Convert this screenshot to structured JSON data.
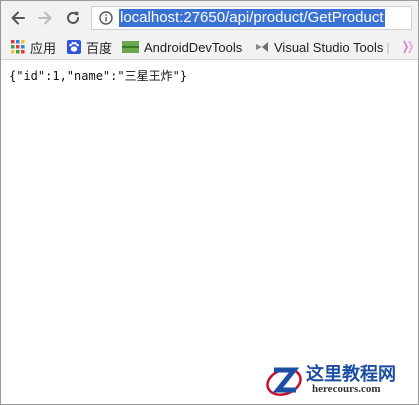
{
  "browser": {
    "url": "localhost:27650/api/product/GetProduct"
  },
  "bookmarks": [
    {
      "label": "应用",
      "icon": "apps-grid-icon"
    },
    {
      "label": "百度",
      "icon": "baidu-paw-icon"
    },
    {
      "label": "AndroidDevTools",
      "icon": "android-dev-tools-icon"
    },
    {
      "label": "Visual Studio Tools",
      "icon": "visual-studio-icon"
    }
  ],
  "page": {
    "json_text": "{\"id\":1,\"name\":\"三星王炸\"}"
  },
  "watermark": {
    "title": "这里教程网",
    "subtitle": "herecours.com"
  },
  "colors": {
    "url_highlight": "#3b73d5",
    "toolbar_bg": "#f2f2f2",
    "watermark_blue": "#1c4fa3",
    "watermark_red": "#c8102e"
  }
}
